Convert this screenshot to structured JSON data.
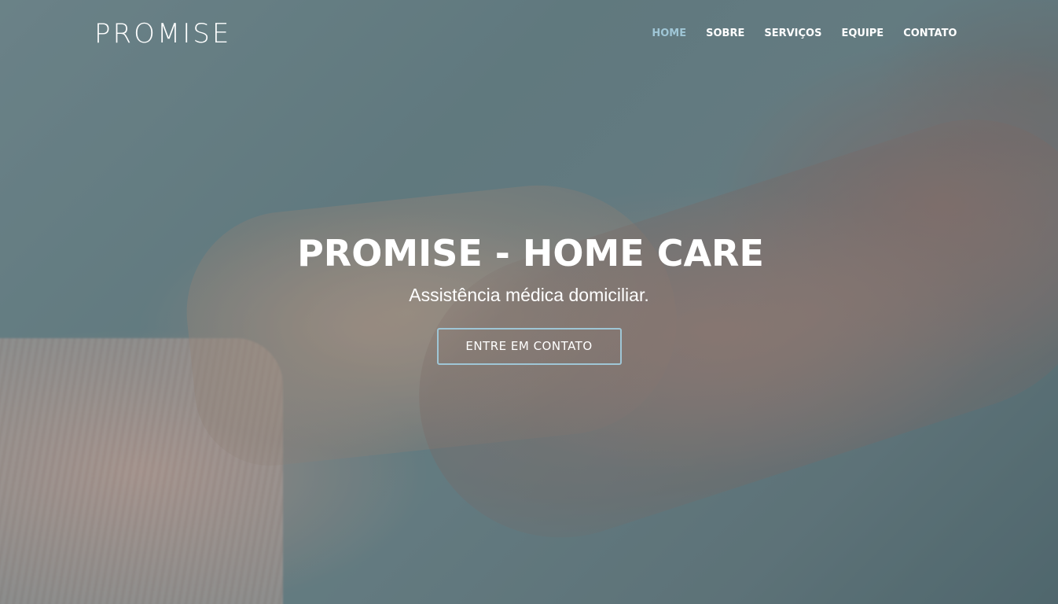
{
  "brand": {
    "name": "PROMISE"
  },
  "nav": {
    "items": [
      {
        "label": "HOME",
        "active": true
      },
      {
        "label": "SOBRE",
        "active": false
      },
      {
        "label": "SERVIÇOS",
        "active": false
      },
      {
        "label": "EQUIPE",
        "active": false
      },
      {
        "label": "CONTATO",
        "active": false
      }
    ]
  },
  "hero": {
    "title": "PROMISE - HOME CARE",
    "subtitle": "Assistência médica domiciliar.",
    "cta_label": "ENTRE EM CONTATO"
  },
  "colors": {
    "accent": "#9fc6d6",
    "text": "#ffffff",
    "overlay": "#46646e"
  }
}
